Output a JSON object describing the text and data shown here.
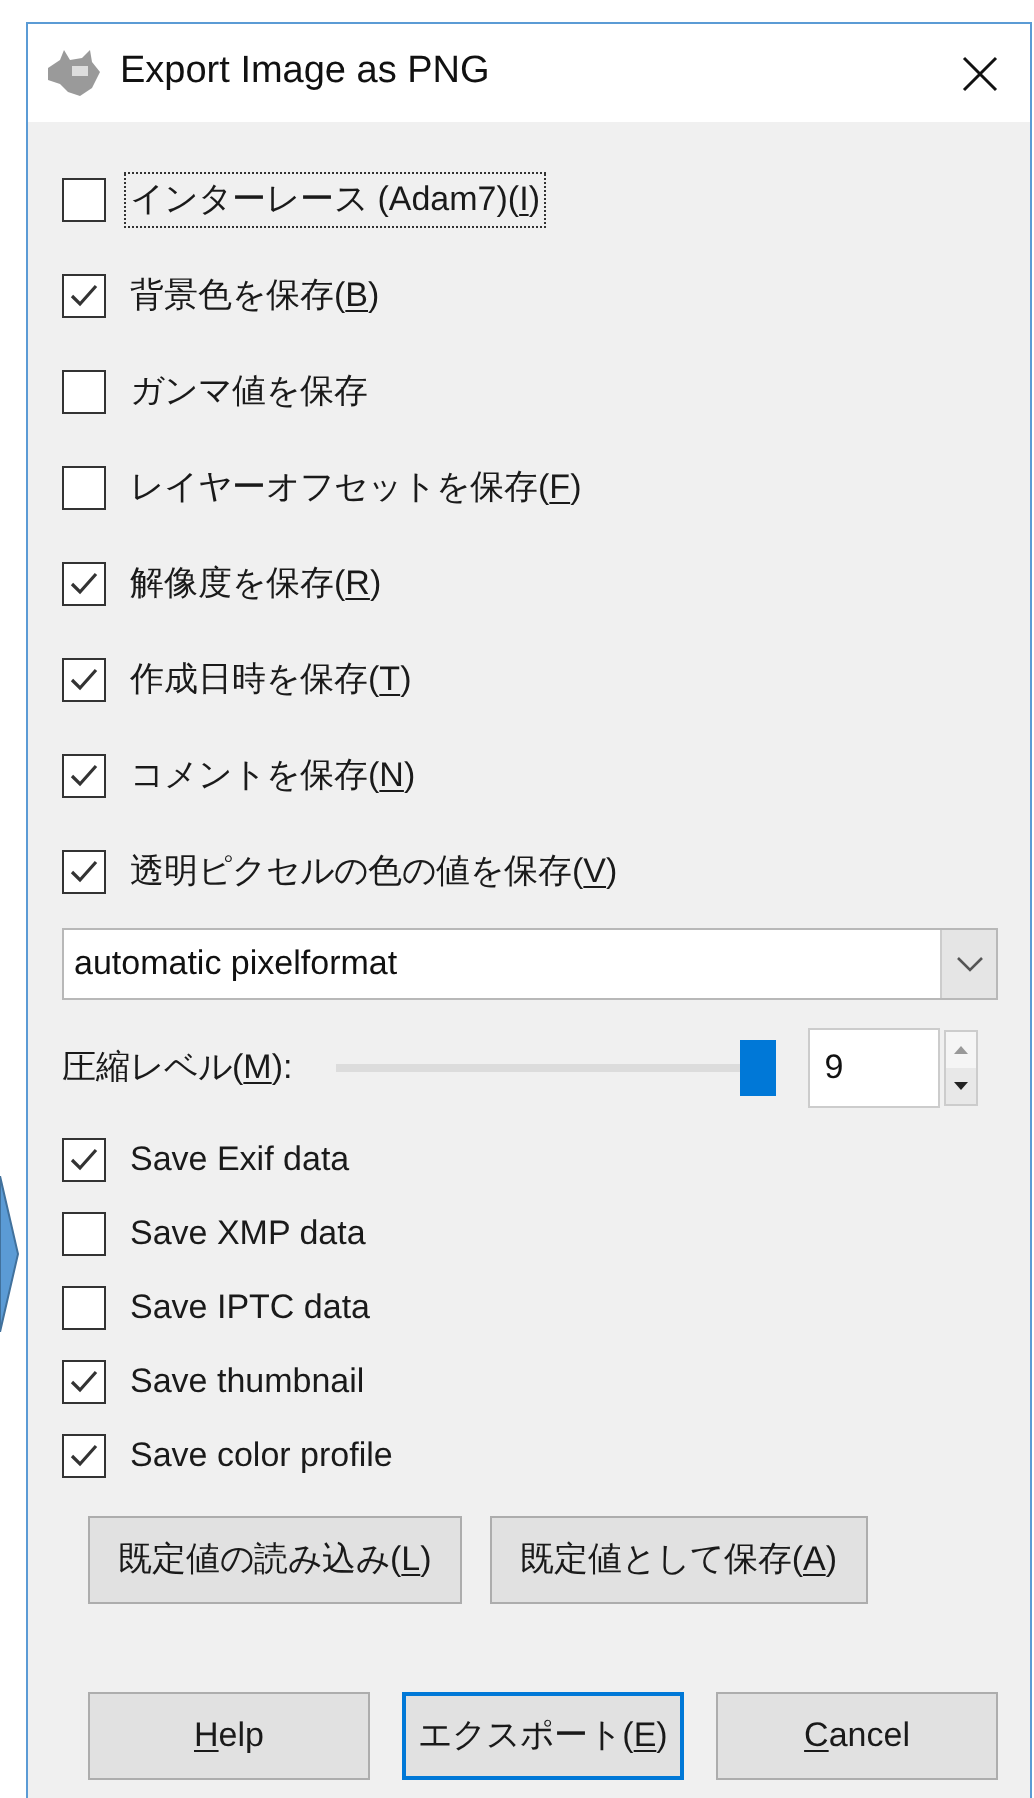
{
  "window": {
    "title": "Export Image as PNG"
  },
  "options": [
    {
      "label": [
        {
          "text": "インターレース (Adam7)(",
          "u": false
        },
        {
          "text": "I",
          "u": true
        },
        {
          "text": ")",
          "u": false
        }
      ],
      "checked": false,
      "focused": true
    },
    {
      "label": [
        {
          "text": "背景色を保存(",
          "u": false
        },
        {
          "text": "B",
          "u": true
        },
        {
          "text": ")",
          "u": false
        }
      ],
      "checked": true,
      "focused": false
    },
    {
      "label": [
        {
          "text": "ガンマ値を保存",
          "u": false
        }
      ],
      "checked": false,
      "focused": false
    },
    {
      "label": [
        {
          "text": "レイヤーオフセットを保存(",
          "u": false
        },
        {
          "text": "F",
          "u": true
        },
        {
          "text": ")",
          "u": false
        }
      ],
      "checked": false,
      "focused": false
    },
    {
      "label": [
        {
          "text": "解像度を保存(",
          "u": false
        },
        {
          "text": "R",
          "u": true
        },
        {
          "text": ")",
          "u": false
        }
      ],
      "checked": true,
      "focused": false
    },
    {
      "label": [
        {
          "text": "作成日時を保存(",
          "u": false
        },
        {
          "text": "T",
          "u": true
        },
        {
          "text": ")",
          "u": false
        }
      ],
      "checked": true,
      "focused": false
    },
    {
      "label": [
        {
          "text": "コメントを保存(",
          "u": false
        },
        {
          "text": "N",
          "u": true
        },
        {
          "text": ")",
          "u": false
        }
      ],
      "checked": true,
      "focused": false
    },
    {
      "label": [
        {
          "text": "透明ピクセルの色の値を保存(",
          "u": false
        },
        {
          "text": "V",
          "u": true
        },
        {
          "text": ")",
          "u": false
        }
      ],
      "checked": true,
      "focused": false
    }
  ],
  "pixelformat": {
    "value": "automatic pixelformat"
  },
  "compression": {
    "label": [
      {
        "text": "圧縮レベル(",
        "u": false
      },
      {
        "text": "M",
        "u": true
      },
      {
        "text": "):",
        "u": false
      }
    ],
    "level": 1.0,
    "value": "9"
  },
  "metadata": [
    {
      "label": [
        {
          "text": "Save Exif data",
          "u": false
        }
      ],
      "checked": true,
      "focused": false
    },
    {
      "label": [
        {
          "text": "Save XMP data",
          "u": false
        }
      ],
      "checked": false,
      "focused": false
    },
    {
      "label": [
        {
          "text": "Save IPTC data",
          "u": false
        }
      ],
      "checked": false,
      "focused": false
    },
    {
      "label": [
        {
          "text": "Save thumbnail",
          "u": false
        }
      ],
      "checked": true,
      "focused": false
    },
    {
      "label": [
        {
          "text": "Save color profile",
          "u": false
        }
      ],
      "checked": true,
      "focused": false
    }
  ],
  "defaults_buttons": [
    {
      "label": [
        {
          "text": "既定値の読み込み(",
          "u": false
        },
        {
          "text": "L",
          "u": true
        },
        {
          "text": ")",
          "u": false
        }
      ],
      "default": false
    },
    {
      "label": [
        {
          "text": "既定値として保存(",
          "u": false
        },
        {
          "text": "A",
          "u": true
        },
        {
          "text": ")",
          "u": false
        }
      ],
      "default": false
    }
  ],
  "action_buttons": [
    {
      "label": [
        {
          "text": "H",
          "u": true
        },
        {
          "text": "elp",
          "u": false
        }
      ],
      "default": false
    },
    {
      "label": [
        {
          "text": "エクスポート(",
          "u": false
        },
        {
          "text": "E",
          "u": true
        },
        {
          "text": ")",
          "u": false
        }
      ],
      "default": true
    },
    {
      "label": [
        {
          "text": "C",
          "u": true
        },
        {
          "text": "ancel",
          "u": false
        }
      ],
      "default": false
    }
  ]
}
